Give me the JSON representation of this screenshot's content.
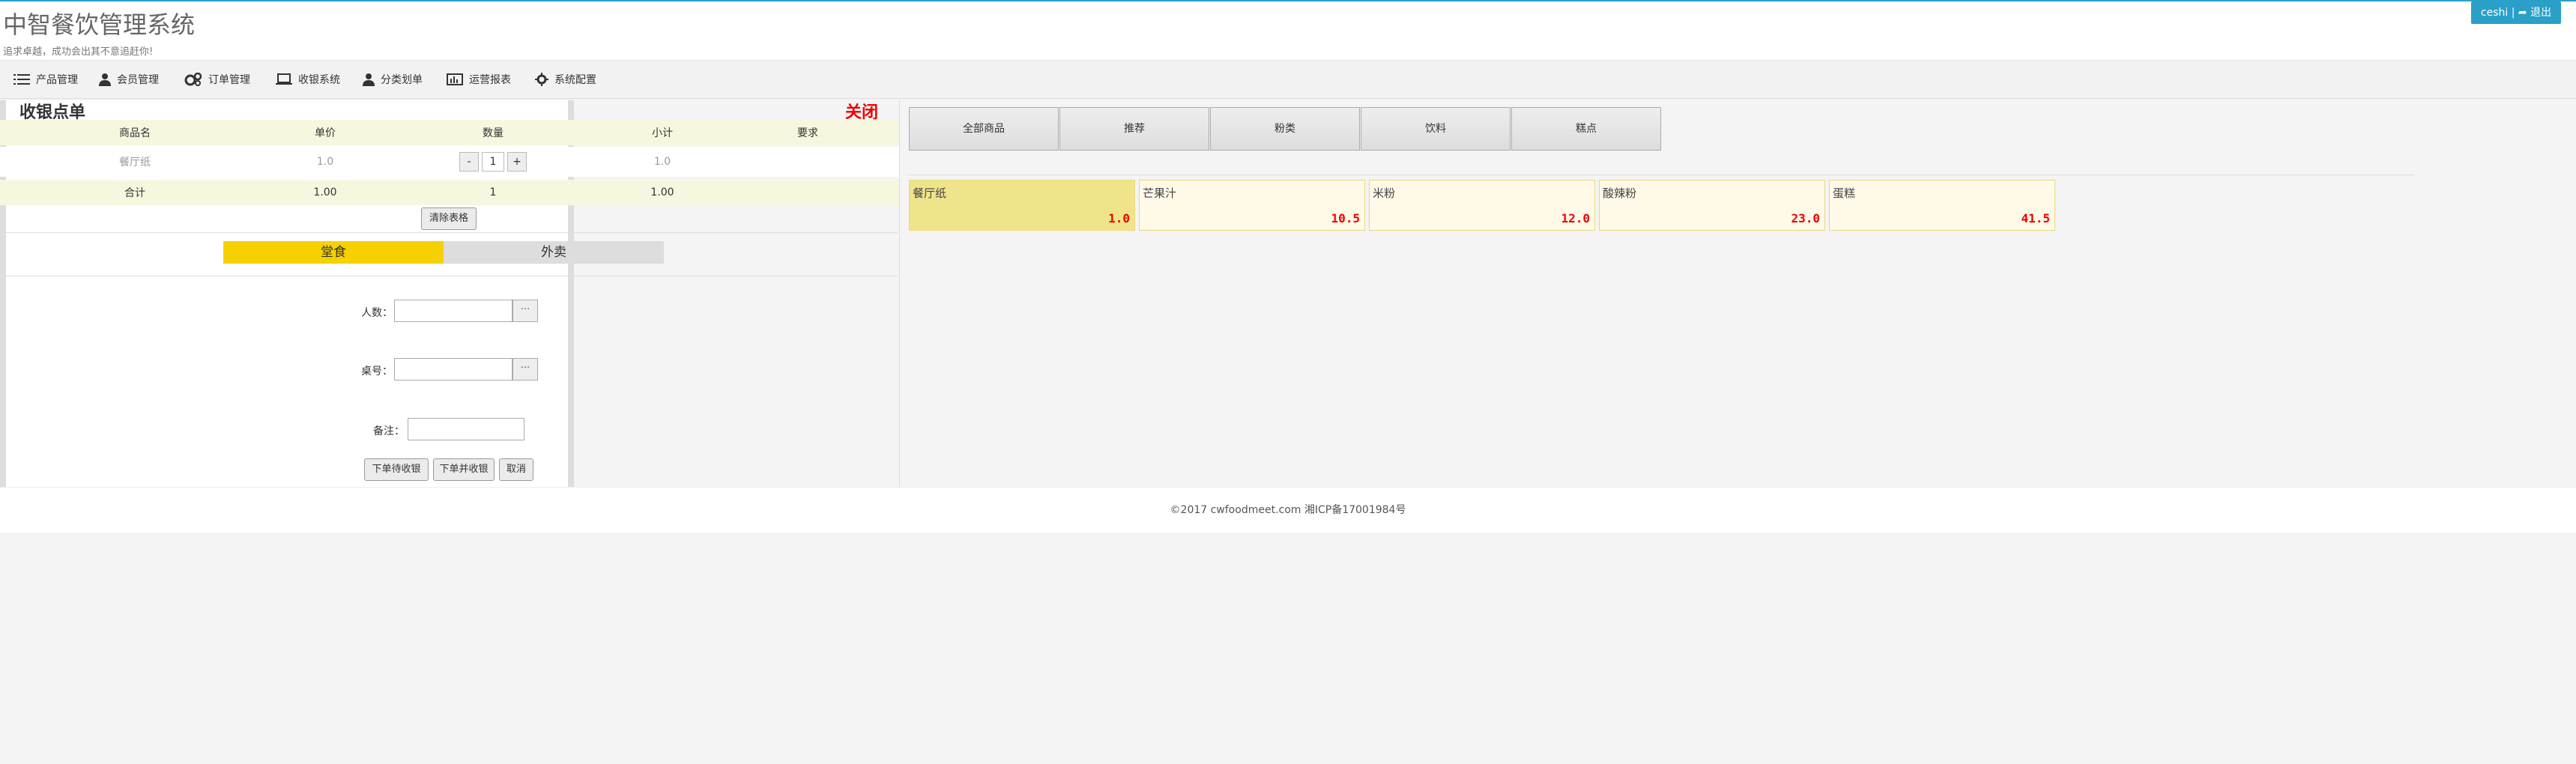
{
  "header": {
    "title": "中智餐饮管理系统",
    "subtitle": "追求卓越，成功会出其不意追赶你!",
    "user_label": "ceshi",
    "logout_label": "退出"
  },
  "nav": {
    "items": [
      {
        "label": "产品管理",
        "icon": "list-icon"
      },
      {
        "label": "会员管理",
        "icon": "user-icon"
      },
      {
        "label": "订单管理",
        "icon": "cogs-icon"
      },
      {
        "label": "收银系统",
        "icon": "laptop-icon"
      },
      {
        "label": "分类划单",
        "icon": "user-icon"
      },
      {
        "label": "运营报表",
        "icon": "bar-chart-icon"
      },
      {
        "label": "系统配置",
        "icon": "gear-icon"
      }
    ]
  },
  "cashier": {
    "title": "收银点单",
    "close_label": "关闭",
    "columns": [
      "商品名",
      "单价",
      "数量",
      "小计",
      "要求"
    ],
    "items": [
      {
        "name": "餐厅纸",
        "price": "1.0",
        "qty": "1",
        "subtotal": "1.0",
        "minus": "-",
        "plus": "+"
      }
    ],
    "total": {
      "label": "合计",
      "price": "1.00",
      "qty": "1",
      "subtotal": "1.00"
    },
    "clear_label": "清除表格",
    "tabs": [
      "堂食",
      "外卖"
    ],
    "fields": {
      "people_label": "人数：",
      "table_label": "桌号：",
      "note_label": "备注：",
      "more_label": "···"
    },
    "actions": [
      "下单待收银",
      "下单并收银",
      "取消"
    ]
  },
  "categories": [
    "全部商品",
    "推荐",
    "粉类",
    "饮料",
    "糕点"
  ],
  "products": [
    {
      "name": "餐厅纸",
      "price": "1.0",
      "selected": true
    },
    {
      "name": "芒果汁",
      "price": "10.5",
      "selected": false
    },
    {
      "name": "米粉",
      "price": "12.0",
      "selected": false
    },
    {
      "name": "酸辣粉",
      "price": "23.0",
      "selected": false
    },
    {
      "name": "蛋糕",
      "price": "41.5",
      "selected": false
    }
  ],
  "footer": {
    "text": "©2017 cwfoodmeet.com 湘ICP备17001984号"
  },
  "colors": {
    "accent": "#2aa0c8",
    "highlight": "#f7d000",
    "price": "#e00000",
    "close": "#e00000"
  }
}
